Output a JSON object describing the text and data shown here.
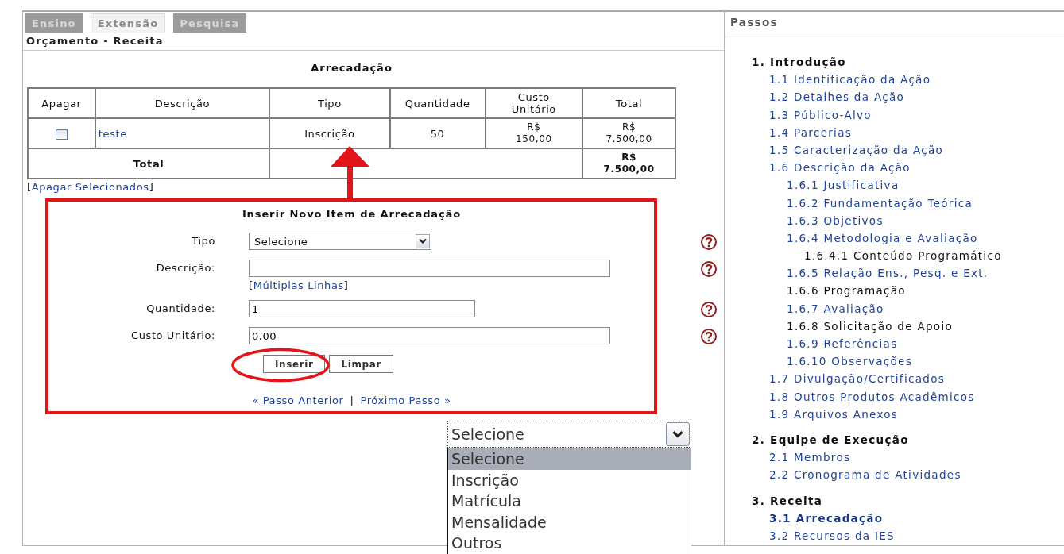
{
  "tabs": [
    {
      "label": "Ensino",
      "selected": false
    },
    {
      "label": "Extensão",
      "selected": true
    },
    {
      "label": "Pesquisa",
      "selected": false
    }
  ],
  "page_title": "Orçamento - Receita",
  "table": {
    "title": "Arrecadação",
    "columns": [
      "Apagar",
      "Descrição",
      "Tipo",
      "Quantidade",
      "Custo\nUnitário",
      "Total"
    ],
    "rows": [
      {
        "checked": false,
        "cells": [
          "",
          "teste",
          "Inscrição",
          "50",
          "R$\n150,00",
          "R$\n7.500,00"
        ]
      }
    ],
    "total_label": "Total",
    "total_value": "R$\n7.500,00"
  },
  "delete_link": {
    "open": "[",
    "label": "Apagar Selecionados",
    "close": "]"
  },
  "form": {
    "title": "Inserir Novo Item de Arrecadação",
    "fields": [
      {
        "kind": "select",
        "label": "Tipo",
        "value": "Selecione"
      },
      {
        "kind": "text",
        "label": "Descrição:",
        "link": {
          "open": "[",
          "label": "Múltiplas Linhas",
          "close": "]"
        }
      },
      {
        "kind": "text",
        "label": "Quantidade:",
        "value": "1"
      },
      {
        "kind": "text",
        "label": "Custo Unitário:",
        "value": "0,00"
      }
    ],
    "buttons": [
      "Inserir",
      "Limpar"
    ],
    "nav": {
      "prev": "« Passo Anterior",
      "separator": "|",
      "next": "Próximo Passo »"
    }
  },
  "dropdown": {
    "value": "Selecione",
    "options": [
      {
        "label": "Selecione",
        "selected": true
      },
      {
        "label": "Inscrição",
        "selected": false
      },
      {
        "label": "Matrícula",
        "selected": false
      },
      {
        "label": "Mensalidade",
        "selected": false
      },
      {
        "label": "Outros",
        "selected": false
      }
    ]
  },
  "sidebar": {
    "title": "Passos",
    "sections": [
      {
        "label": "1. Introdução",
        "children": [
          {
            "label": "1.1 Identificação da Ação",
            "disabled": false,
            "selected": false
          },
          {
            "label": "1.2 Detalhes da Ação",
            "disabled": false,
            "selected": false
          },
          {
            "label": "1.3 Público-Alvo",
            "disabled": false,
            "selected": false
          },
          {
            "label": "1.4 Parcerias",
            "disabled": false,
            "selected": false
          },
          {
            "label": "1.5 Caracterização da Ação",
            "disabled": false,
            "selected": false
          },
          {
            "label": "1.6 Descrição da Ação",
            "disabled": false,
            "selected": false,
            "children": [
              {
                "label": "1.6.1 Justificativa",
                "disabled": false,
                "selected": false
              },
              {
                "label": "1.6.2 Fundamentação Teórica",
                "disabled": false,
                "selected": false
              },
              {
                "label": "1.6.3 Objetivos",
                "disabled": false,
                "selected": false
              },
              {
                "label": "1.6.4 Metodologia e Avaliação",
                "disabled": false,
                "selected": false,
                "children": [
                  {
                    "label": "1.6.4.1 Conteúdo Programático",
                    "disabled": true,
                    "selected": false
                  }
                ]
              },
              {
                "label": "1.6.5 Relação Ens., Pesq. e Ext.",
                "disabled": false,
                "selected": false
              },
              {
                "label": "1.6.6 Programação",
                "disabled": true,
                "selected": false
              },
              {
                "label": "1.6.7 Avaliação",
                "disabled": false,
                "selected": false
              },
              {
                "label": "1.6.8 Solicitação de Apoio",
                "disabled": true,
                "selected": false
              },
              {
                "label": "1.6.9 Referências",
                "disabled": false,
                "selected": false
              },
              {
                "label": "1.6.10 Observações",
                "disabled": false,
                "selected": false
              }
            ]
          },
          {
            "label": "1.7 Divulgação/Certificados",
            "disabled": false,
            "selected": false
          },
          {
            "label": "1.8 Outros Produtos Acadêmicos",
            "disabled": false,
            "selected": false
          },
          {
            "label": "1.9 Arquivos Anexos",
            "disabled": false,
            "selected": false
          }
        ]
      },
      {
        "label": "2. Equipe de Execução",
        "children": [
          {
            "label": "2.1 Membros",
            "disabled": false,
            "selected": false
          },
          {
            "label": "2.2 Cronograma de Atividades",
            "disabled": false,
            "selected": false
          }
        ]
      },
      {
        "label": "3. Receita",
        "children": [
          {
            "label": "3.1 Arrecadação",
            "disabled": false,
            "selected": true
          },
          {
            "label": "3.2 Recursos da IES",
            "disabled": false,
            "selected": false
          }
        ]
      }
    ]
  }
}
